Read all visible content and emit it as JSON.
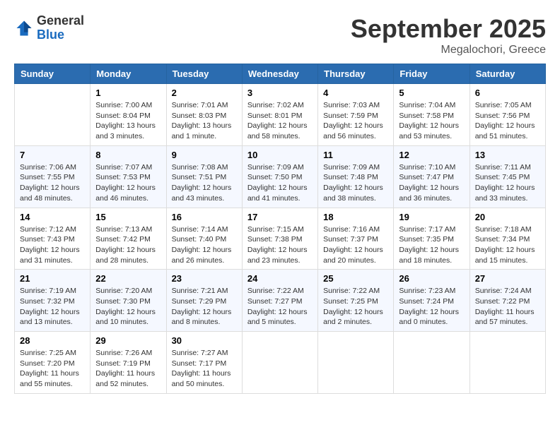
{
  "header": {
    "logo_general": "General",
    "logo_blue": "Blue",
    "month_title": "September 2025",
    "location": "Megalochori, Greece"
  },
  "days_of_week": [
    "Sunday",
    "Monday",
    "Tuesday",
    "Wednesday",
    "Thursday",
    "Friday",
    "Saturday"
  ],
  "weeks": [
    [
      {
        "day": null
      },
      {
        "day": 1,
        "sunrise": "7:00 AM",
        "sunset": "8:04 PM",
        "daylight": "13 hours and 3 minutes."
      },
      {
        "day": 2,
        "sunrise": "7:01 AM",
        "sunset": "8:03 PM",
        "daylight": "13 hours and 1 minute."
      },
      {
        "day": 3,
        "sunrise": "7:02 AM",
        "sunset": "8:01 PM",
        "daylight": "12 hours and 58 minutes."
      },
      {
        "day": 4,
        "sunrise": "7:03 AM",
        "sunset": "7:59 PM",
        "daylight": "12 hours and 56 minutes."
      },
      {
        "day": 5,
        "sunrise": "7:04 AM",
        "sunset": "7:58 PM",
        "daylight": "12 hours and 53 minutes."
      },
      {
        "day": 6,
        "sunrise": "7:05 AM",
        "sunset": "7:56 PM",
        "daylight": "12 hours and 51 minutes."
      }
    ],
    [
      {
        "day": 7,
        "sunrise": "7:06 AM",
        "sunset": "7:55 PM",
        "daylight": "12 hours and 48 minutes."
      },
      {
        "day": 8,
        "sunrise": "7:07 AM",
        "sunset": "7:53 PM",
        "daylight": "12 hours and 46 minutes."
      },
      {
        "day": 9,
        "sunrise": "7:08 AM",
        "sunset": "7:51 PM",
        "daylight": "12 hours and 43 minutes."
      },
      {
        "day": 10,
        "sunrise": "7:09 AM",
        "sunset": "7:50 PM",
        "daylight": "12 hours and 41 minutes."
      },
      {
        "day": 11,
        "sunrise": "7:09 AM",
        "sunset": "7:48 PM",
        "daylight": "12 hours and 38 minutes."
      },
      {
        "day": 12,
        "sunrise": "7:10 AM",
        "sunset": "7:47 PM",
        "daylight": "12 hours and 36 minutes."
      },
      {
        "day": 13,
        "sunrise": "7:11 AM",
        "sunset": "7:45 PM",
        "daylight": "12 hours and 33 minutes."
      }
    ],
    [
      {
        "day": 14,
        "sunrise": "7:12 AM",
        "sunset": "7:43 PM",
        "daylight": "12 hours and 31 minutes."
      },
      {
        "day": 15,
        "sunrise": "7:13 AM",
        "sunset": "7:42 PM",
        "daylight": "12 hours and 28 minutes."
      },
      {
        "day": 16,
        "sunrise": "7:14 AM",
        "sunset": "7:40 PM",
        "daylight": "12 hours and 26 minutes."
      },
      {
        "day": 17,
        "sunrise": "7:15 AM",
        "sunset": "7:38 PM",
        "daylight": "12 hours and 23 minutes."
      },
      {
        "day": 18,
        "sunrise": "7:16 AM",
        "sunset": "7:37 PM",
        "daylight": "12 hours and 20 minutes."
      },
      {
        "day": 19,
        "sunrise": "7:17 AM",
        "sunset": "7:35 PM",
        "daylight": "12 hours and 18 minutes."
      },
      {
        "day": 20,
        "sunrise": "7:18 AM",
        "sunset": "7:34 PM",
        "daylight": "12 hours and 15 minutes."
      }
    ],
    [
      {
        "day": 21,
        "sunrise": "7:19 AM",
        "sunset": "7:32 PM",
        "daylight": "12 hours and 13 minutes."
      },
      {
        "day": 22,
        "sunrise": "7:20 AM",
        "sunset": "7:30 PM",
        "daylight": "12 hours and 10 minutes."
      },
      {
        "day": 23,
        "sunrise": "7:21 AM",
        "sunset": "7:29 PM",
        "daylight": "12 hours and 8 minutes."
      },
      {
        "day": 24,
        "sunrise": "7:22 AM",
        "sunset": "7:27 PM",
        "daylight": "12 hours and 5 minutes."
      },
      {
        "day": 25,
        "sunrise": "7:22 AM",
        "sunset": "7:25 PM",
        "daylight": "12 hours and 2 minutes."
      },
      {
        "day": 26,
        "sunrise": "7:23 AM",
        "sunset": "7:24 PM",
        "daylight": "12 hours and 0 minutes."
      },
      {
        "day": 27,
        "sunrise": "7:24 AM",
        "sunset": "7:22 PM",
        "daylight": "11 hours and 57 minutes."
      }
    ],
    [
      {
        "day": 28,
        "sunrise": "7:25 AM",
        "sunset": "7:20 PM",
        "daylight": "11 hours and 55 minutes."
      },
      {
        "day": 29,
        "sunrise": "7:26 AM",
        "sunset": "7:19 PM",
        "daylight": "11 hours and 52 minutes."
      },
      {
        "day": 30,
        "sunrise": "7:27 AM",
        "sunset": "7:17 PM",
        "daylight": "11 hours and 50 minutes."
      },
      {
        "day": null
      },
      {
        "day": null
      },
      {
        "day": null
      },
      {
        "day": null
      }
    ]
  ]
}
